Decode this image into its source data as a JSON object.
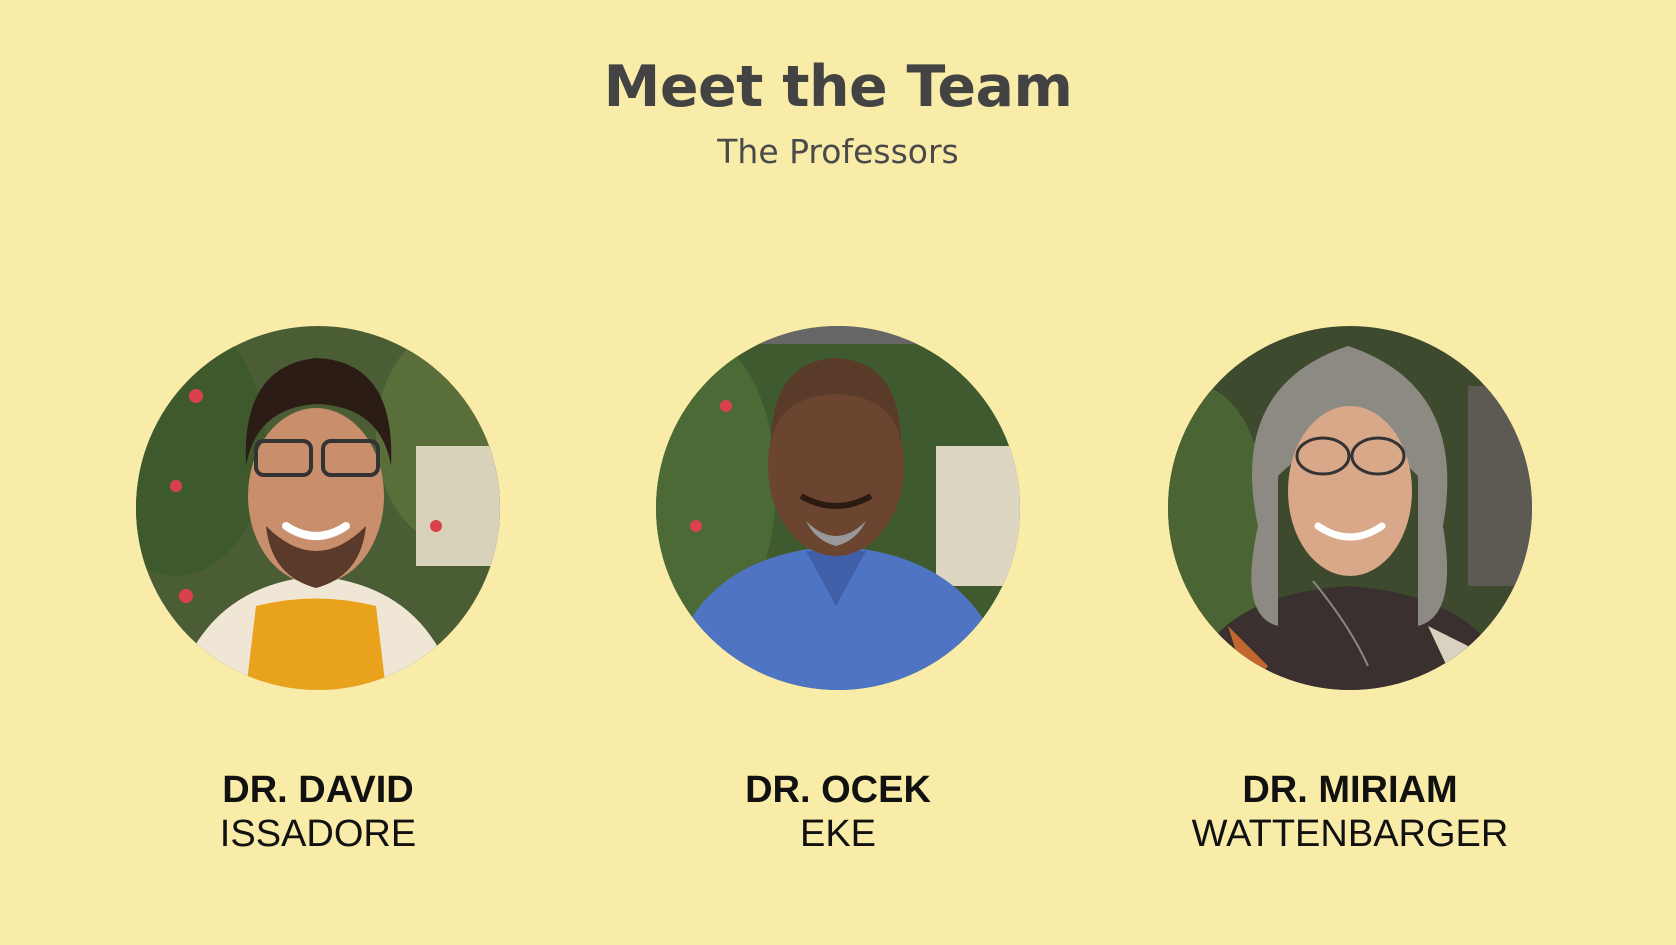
{
  "header": {
    "title": "Meet the Team",
    "subtitle": "The Professors"
  },
  "team": [
    {
      "first": "DR. DAVID",
      "last": "ISSADORE",
      "photo_icon": "portrait-photo-icon",
      "shirt_color": "#e9a21c"
    },
    {
      "first": "DR. OCEK",
      "last": "EKE",
      "photo_icon": "portrait-photo-icon",
      "shirt_color": "#4f74c4"
    },
    {
      "first": "DR. MIRIAM",
      "last": "WATTENBARGER",
      "photo_icon": "portrait-photo-icon",
      "shirt_color": "#3a3030"
    }
  ],
  "colors": {
    "background": "#f9eca8",
    "title": "#434343",
    "name": "#111111"
  }
}
